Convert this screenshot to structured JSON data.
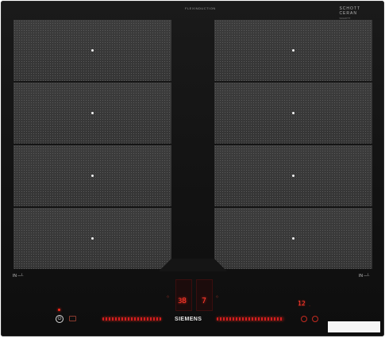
{
  "product": {
    "brand": "SIEMENS",
    "top_label": "flexInduction",
    "glass_brand_line1": "SCHOTT",
    "glass_brand_line2": "CERAN",
    "glass_brand_small": "SCHOTT"
  },
  "zones": {
    "left_label": "IN",
    "right_label": "IN"
  },
  "displays": {
    "left_digit": "8",
    "left_sub": "3",
    "right_digit": "7",
    "timer_value": "12"
  },
  "colors": {
    "glass": "#141414",
    "zone_fill": "#3a3a3a",
    "led_red": "#ff2a1a",
    "text_light": "#e6e6e6"
  },
  "icons": {
    "power": "power-icon",
    "lock": "lock-icon",
    "induction_symbol": "induction-icon"
  }
}
